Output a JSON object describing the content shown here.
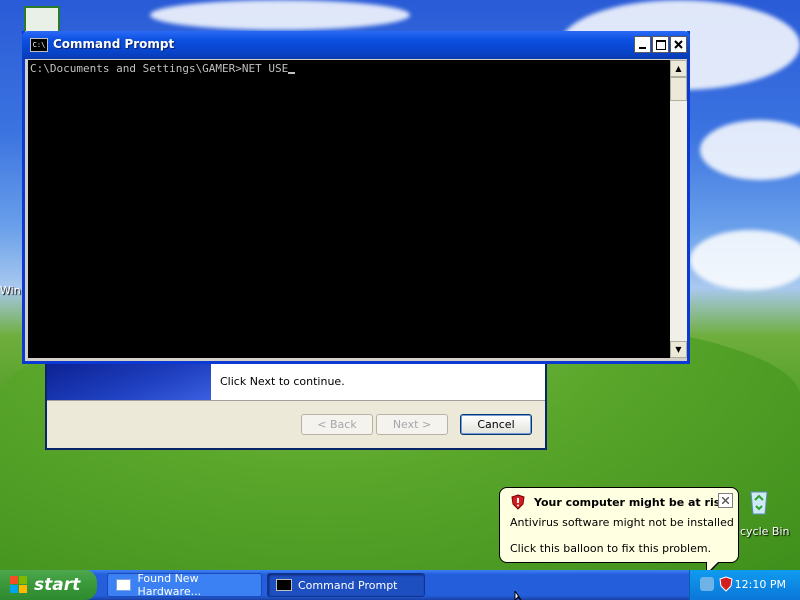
{
  "desktop": {
    "recycle_bin_label": "cycle Bin",
    "side_label": "Win"
  },
  "cmd_window": {
    "title": "Command Prompt",
    "title_icon_text": "C:\\",
    "console_line": "C:\\Documents and Settings\\GAMER>NET USE"
  },
  "wizard": {
    "message": "Click Next to continue.",
    "back_label": "< Back",
    "next_label": "Next >",
    "cancel_label": "Cancel"
  },
  "balloon": {
    "title": "Your computer might be at risk",
    "line1": "Antivirus software might not be installed",
    "line2": "Click this balloon to fix this problem."
  },
  "taskbar": {
    "start_label": "start",
    "tasks": [
      {
        "label": "Found New Hardware..."
      },
      {
        "label": "Command Prompt"
      }
    ],
    "clock": "12:10 PM"
  },
  "colors": {
    "titlebar": "#0a4ee0",
    "taskbar": "#245edb",
    "start": "#3c9a3c",
    "balloon_bg": "#ffffe1",
    "console_bg": "#000000",
    "console_fg": "#c0c0c0"
  },
  "icons": [
    "windows-flag-icon",
    "cmd-icon",
    "shield-warning-icon",
    "close-icon",
    "recycle-bin-icon",
    "desktop-shortcut-icon"
  ]
}
